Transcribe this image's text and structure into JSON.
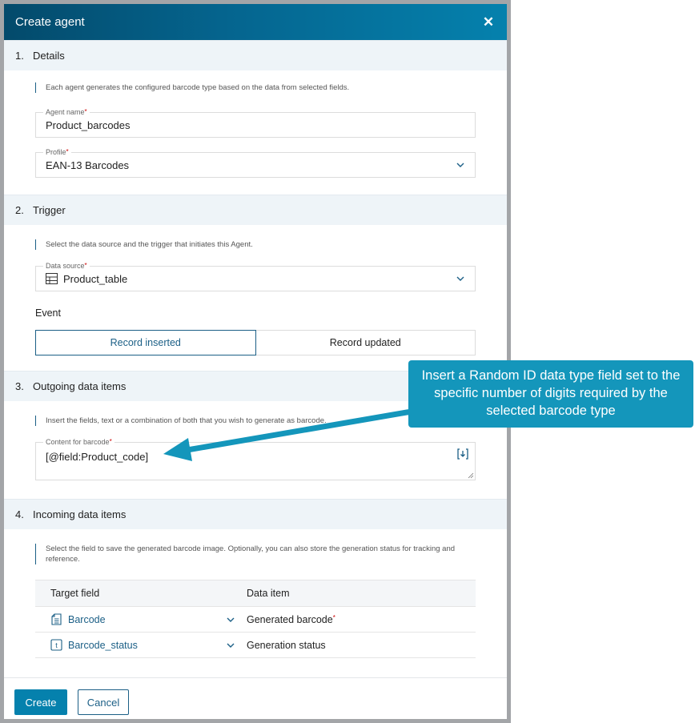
{
  "dialog": {
    "title": "Create agent",
    "close_icon": "close-icon"
  },
  "sections": {
    "details": {
      "number": "1.",
      "title": "Details",
      "hint": "Each agent generates the configured barcode type based on the data from selected fields.",
      "agent_name": {
        "label": "Agent name",
        "value": "Product_barcodes",
        "required": "*"
      },
      "profile": {
        "label": "Profile",
        "value": "EAN-13 Barcodes",
        "required": "*"
      }
    },
    "trigger": {
      "number": "2.",
      "title": "Trigger",
      "hint": "Select the data source and the trigger that initiates this Agent.",
      "data_source": {
        "label": "Data source",
        "value": "Product_table",
        "required": "*",
        "icon": "table-icon"
      },
      "event_label": "Event",
      "events": [
        {
          "label": "Record inserted",
          "selected": true
        },
        {
          "label": "Record updated",
          "selected": false
        }
      ]
    },
    "outgoing": {
      "number": "3.",
      "title": "Outgoing data items",
      "hint": "Insert the fields, text or a combination of both that you wish to generate as barcode.",
      "content": {
        "label": "Content for barcode",
        "value": "[@field:Product_code]",
        "required": "*"
      }
    },
    "incoming": {
      "number": "4.",
      "title": "Incoming data items",
      "hint": "Select the field to save the generated barcode image. Optionally, you can also store the generation status for tracking and reference.",
      "columns": [
        "Target field",
        "Data item"
      ],
      "rows": [
        {
          "target_field": "Barcode",
          "icon": "file-field-icon",
          "data_item": "Generated barcode",
          "required": "*"
        },
        {
          "target_field": "Barcode_status",
          "icon": "text-field-icon",
          "data_item": "Generation status",
          "required": ""
        }
      ]
    }
  },
  "footer": {
    "create_label": "Create",
    "cancel_label": "Cancel"
  },
  "annotation": {
    "text": "Insert a Random ID data type field set to the specific number of digits required by the selected barcode type",
    "color": "#1496bb"
  }
}
